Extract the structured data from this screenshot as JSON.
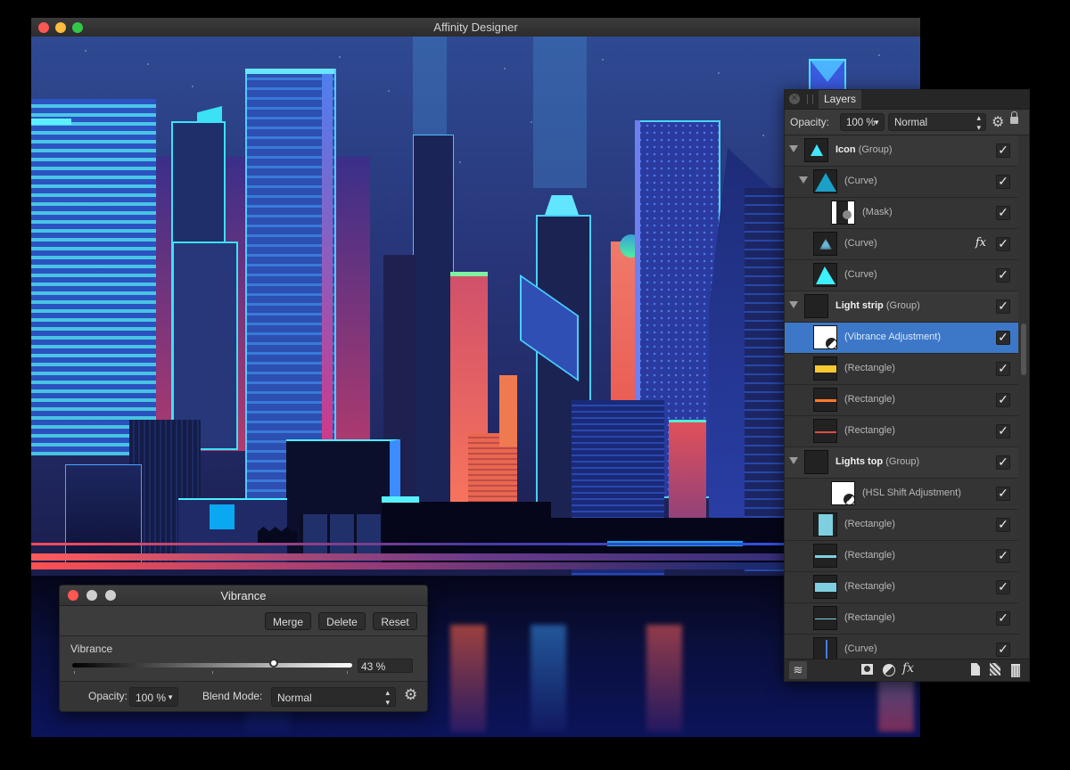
{
  "window": {
    "title": "Affinity Designer",
    "traffic_lights": [
      {
        "name": "close",
        "color": "#fc5753"
      },
      {
        "name": "minimize",
        "color": "#fdbc40"
      },
      {
        "name": "zoom",
        "color": "#33c748"
      }
    ]
  },
  "layers_panel": {
    "tab_label": "Layers",
    "close_icon": "close-circle-icon",
    "opacity_label": "Opacity:",
    "opacity_value": "100 %",
    "blend_mode": "Normal",
    "settings_icon": "gear-icon",
    "lock_icon": "lock-icon",
    "rows": [
      {
        "name": "Icon",
        "type": "(Group)",
        "bold": true,
        "expanded": true,
        "selected": false,
        "visible": true,
        "fx": false,
        "thumb": "cyan-triangle"
      },
      {
        "name": "",
        "type": "(Curve)",
        "bold": false,
        "expanded": true,
        "selected": false,
        "visible": true,
        "fx": false,
        "thumb": "blue-triangle"
      },
      {
        "name": "",
        "type": "(Mask)",
        "bold": false,
        "expanded": false,
        "selected": false,
        "visible": true,
        "fx": false,
        "thumb": "mask"
      },
      {
        "name": "",
        "type": "(Curve)",
        "bold": false,
        "expanded": false,
        "selected": false,
        "visible": true,
        "fx": true,
        "thumb": "blurred-triangle"
      },
      {
        "name": "",
        "type": "(Curve)",
        "bold": false,
        "expanded": false,
        "selected": false,
        "visible": true,
        "fx": false,
        "thumb": "bright-triangle"
      },
      {
        "name": "Light strip",
        "type": "(Group)",
        "bold": true,
        "expanded": true,
        "selected": false,
        "visible": true,
        "fx": false,
        "thumb": "dark"
      },
      {
        "name": "",
        "type": "(Vibrance Adjustment)",
        "bold": false,
        "expanded": false,
        "selected": true,
        "visible": true,
        "fx": false,
        "thumb": "adjustment"
      },
      {
        "name": "",
        "type": "(Rectangle)",
        "bold": false,
        "expanded": false,
        "selected": false,
        "visible": true,
        "fx": false,
        "thumb": "yellow-bar"
      },
      {
        "name": "",
        "type": "(Rectangle)",
        "bold": false,
        "expanded": false,
        "selected": false,
        "visible": true,
        "fx": false,
        "thumb": "orange-line"
      },
      {
        "name": "",
        "type": "(Rectangle)",
        "bold": false,
        "expanded": false,
        "selected": false,
        "visible": true,
        "fx": false,
        "thumb": "red-line"
      },
      {
        "name": "Lights top",
        "type": "(Group)",
        "bold": true,
        "expanded": true,
        "selected": false,
        "visible": true,
        "fx": false,
        "thumb": "dark"
      },
      {
        "name": "",
        "type": "(HSL Shift Adjustment)",
        "bold": false,
        "expanded": false,
        "selected": false,
        "visible": true,
        "fx": false,
        "thumb": "adjustment"
      },
      {
        "name": "",
        "type": "(Rectangle)",
        "bold": false,
        "expanded": false,
        "selected": false,
        "visible": true,
        "fx": false,
        "thumb": "teal-tall"
      },
      {
        "name": "",
        "type": "(Rectangle)",
        "bold": false,
        "expanded": false,
        "selected": false,
        "visible": true,
        "fx": false,
        "thumb": "teal-line"
      },
      {
        "name": "",
        "type": "(Rectangle)",
        "bold": false,
        "expanded": false,
        "selected": false,
        "visible": true,
        "fx": false,
        "thumb": "teal-bar"
      },
      {
        "name": "",
        "type": "(Rectangle)",
        "bold": false,
        "expanded": false,
        "selected": false,
        "visible": true,
        "fx": false,
        "thumb": "teal-thin"
      },
      {
        "name": "",
        "type": "(Curve)",
        "bold": false,
        "expanded": false,
        "selected": false,
        "visible": true,
        "fx": false,
        "thumb": "blue-stroke"
      }
    ],
    "footer_icons": [
      "layers-icon",
      "mask-icon",
      "adjustment-icon",
      "fx-icon",
      "new-layer-icon",
      "new-pixel-layer-icon",
      "trash-icon"
    ],
    "fx_label": "fx",
    "selected_color": "#3d78c8"
  },
  "vibrance_dialog": {
    "title": "Vibrance",
    "buttons": {
      "merge": "Merge",
      "delete": "Delete",
      "reset": "Reset"
    },
    "vibrance_label": "Vibrance",
    "vibrance_value": "43 %",
    "vibrance_slider_fraction": 0.72,
    "opacity_label": "Opacity:",
    "opacity_value": "100 %",
    "blend_mode_label": "Blend Mode:",
    "blend_mode_value": "Normal",
    "settings_icon": "gear-icon"
  }
}
